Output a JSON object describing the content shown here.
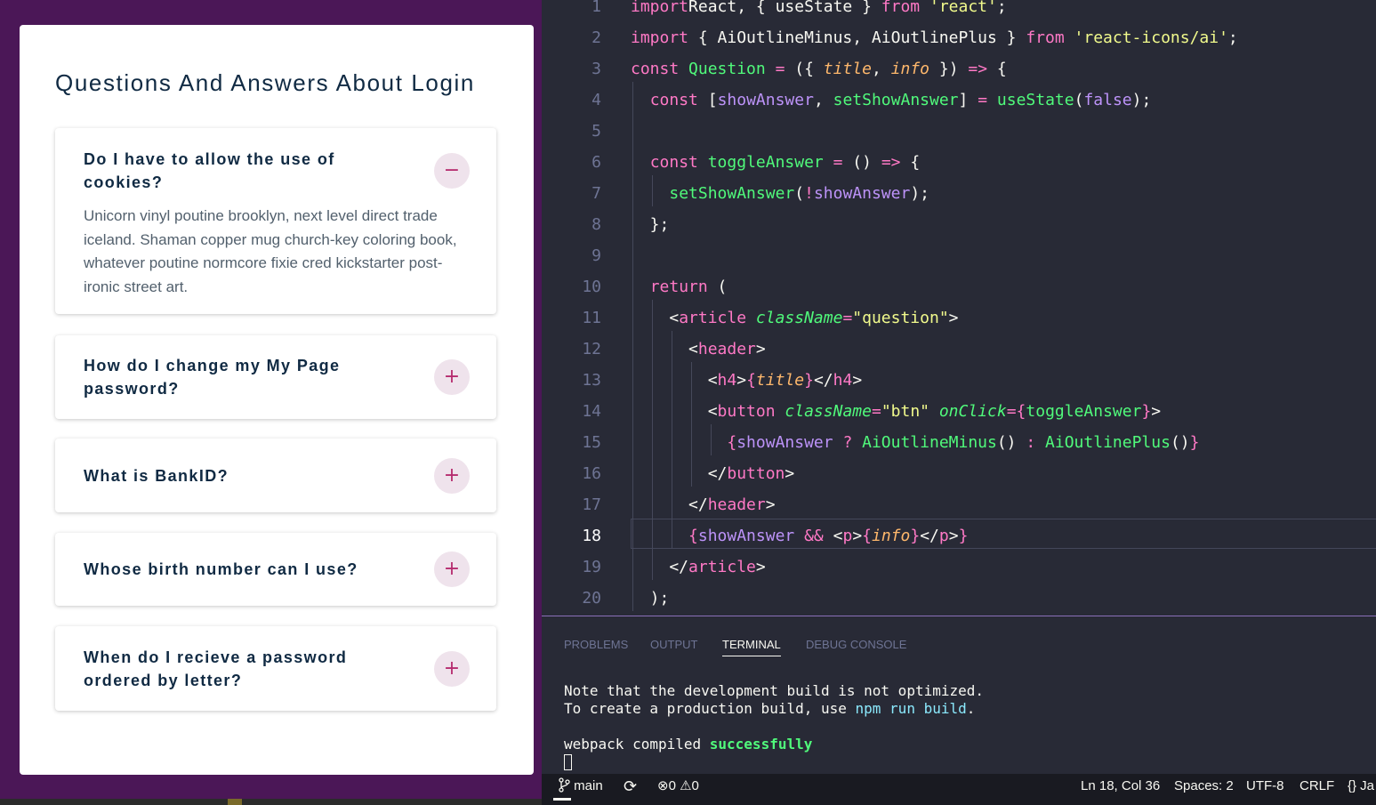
{
  "app": {
    "title": "Questions And Answers About Login",
    "questions": [
      {
        "title": "Do I have to allow the use of cookies?",
        "expanded": true,
        "button_icon": "minus-icon",
        "button_symbol": "−",
        "info": "Unicorn vinyl poutine brooklyn, next level direct trade iceland. Shaman copper mug church-key coloring book, whatever poutine normcore fixie cred kickstarter post-ironic street art."
      },
      {
        "title": "How do I change my My Page password?",
        "expanded": false,
        "button_icon": "plus-icon",
        "button_symbol": "+"
      },
      {
        "title": "What is BankID?",
        "expanded": false,
        "button_icon": "plus-icon",
        "button_symbol": "+"
      },
      {
        "title": "Whose birth number can I use?",
        "expanded": false,
        "button_icon": "plus-icon",
        "button_symbol": "+"
      },
      {
        "title": "When do I recieve a password ordered by letter?",
        "expanded": false,
        "button_icon": "plus-icon",
        "button_symbol": "+"
      }
    ]
  },
  "editor": {
    "current_line": 18,
    "lines": [
      {
        "n": "1",
        "tokens": [
          [
            "k",
            "import"
          ],
          [
            "",
            "React, { useState } "
          ],
          [
            "k",
            "from"
          ],
          [
            "",
            " "
          ],
          [
            "s",
            "'react'"
          ],
          [
            "",
            ";"
          ]
        ]
      },
      {
        "n": "2",
        "tokens": [
          [
            "k",
            "import"
          ],
          [
            "",
            " { AiOutlineMinus, AiOutlinePlus } "
          ],
          [
            "k",
            "from"
          ],
          [
            "",
            " "
          ],
          [
            "s",
            "'react-icons/ai'"
          ],
          [
            "",
            ";"
          ]
        ]
      },
      {
        "n": "3",
        "tokens": [
          [
            "k",
            "const"
          ],
          [
            "",
            " "
          ],
          [
            "f",
            "Question"
          ],
          [
            "",
            " "
          ],
          [
            "k",
            "="
          ],
          [
            "",
            " ({ "
          ],
          [
            "p",
            "title"
          ],
          [
            "",
            ", "
          ],
          [
            "p",
            "info"
          ],
          [
            "",
            " }) "
          ],
          [
            "k",
            "=>"
          ],
          [
            "",
            " {"
          ]
        ]
      },
      {
        "n": "4",
        "tokens": [
          [
            "",
            "  "
          ],
          [
            "k",
            "const"
          ],
          [
            "",
            " ["
          ],
          [
            "v",
            "showAnswer"
          ],
          [
            "",
            ", "
          ],
          [
            "f",
            "setShowAnswer"
          ],
          [
            "",
            "] "
          ],
          [
            "k",
            "="
          ],
          [
            "",
            " "
          ],
          [
            "f",
            "useState"
          ],
          [
            "",
            "("
          ],
          [
            "v",
            "false"
          ],
          [
            "",
            ");"
          ]
        ]
      },
      {
        "n": "5",
        "tokens": []
      },
      {
        "n": "6",
        "tokens": [
          [
            "",
            "  "
          ],
          [
            "k",
            "const"
          ],
          [
            "",
            " "
          ],
          [
            "f",
            "toggleAnswer"
          ],
          [
            "",
            " "
          ],
          [
            "k",
            "="
          ],
          [
            "",
            " () "
          ],
          [
            "k",
            "=>"
          ],
          [
            "",
            " {"
          ]
        ]
      },
      {
        "n": "7",
        "tokens": [
          [
            "",
            "    "
          ],
          [
            "f",
            "setShowAnswer"
          ],
          [
            "",
            "("
          ],
          [
            "k",
            "!"
          ],
          [
            "v",
            "showAnswer"
          ],
          [
            "",
            ");"
          ]
        ]
      },
      {
        "n": "8",
        "tokens": [
          [
            "",
            "  };"
          ]
        ]
      },
      {
        "n": "9",
        "tokens": []
      },
      {
        "n": "10",
        "tokens": [
          [
            "",
            "  "
          ],
          [
            "k",
            "return"
          ],
          [
            "",
            " ("
          ]
        ]
      },
      {
        "n": "11",
        "tokens": [
          [
            "",
            "    <"
          ],
          [
            "k",
            "article"
          ],
          [
            "",
            " "
          ],
          [
            "a",
            "className"
          ],
          [
            "k",
            "="
          ],
          [
            "s",
            "\"question\""
          ],
          [
            "",
            ">"
          ]
        ]
      },
      {
        "n": "12",
        "tokens": [
          [
            "",
            "      <"
          ],
          [
            "k",
            "header"
          ],
          [
            "",
            ">"
          ]
        ]
      },
      {
        "n": "13",
        "tokens": [
          [
            "",
            "        <"
          ],
          [
            "k",
            "h4"
          ],
          [
            "",
            ">"
          ],
          [
            "k",
            "{"
          ],
          [
            "p",
            "title"
          ],
          [
            "k",
            "}"
          ],
          [
            "",
            "</"
          ],
          [
            "k",
            "h4"
          ],
          [
            "",
            ">"
          ]
        ]
      },
      {
        "n": "14",
        "tokens": [
          [
            "",
            "        <"
          ],
          [
            "k",
            "button"
          ],
          [
            "",
            " "
          ],
          [
            "a",
            "className"
          ],
          [
            "k",
            "="
          ],
          [
            "s",
            "\"btn\""
          ],
          [
            "",
            " "
          ],
          [
            "a",
            "onClick"
          ],
          [
            "k",
            "={"
          ],
          [
            "f",
            "toggleAnswer"
          ],
          [
            "k",
            "}"
          ],
          [
            "",
            ">"
          ]
        ]
      },
      {
        "n": "15",
        "tokens": [
          [
            "",
            "          "
          ],
          [
            "k",
            "{"
          ],
          [
            "v",
            "showAnswer"
          ],
          [
            "",
            " "
          ],
          [
            "k",
            "?"
          ],
          [
            "",
            " "
          ],
          [
            "f",
            "AiOutlineMinus"
          ],
          [
            "",
            "() "
          ],
          [
            "k",
            ":"
          ],
          [
            "",
            " "
          ],
          [
            "f",
            "AiOutlinePlus"
          ],
          [
            "",
            "()"
          ],
          [
            "k",
            "}"
          ]
        ]
      },
      {
        "n": "16",
        "tokens": [
          [
            "",
            "        </"
          ],
          [
            "k",
            "button"
          ],
          [
            "",
            ">"
          ]
        ]
      },
      {
        "n": "17",
        "tokens": [
          [
            "",
            "      </"
          ],
          [
            "k",
            "header"
          ],
          [
            "",
            ">"
          ]
        ]
      },
      {
        "n": "18",
        "tokens": [
          [
            "",
            "      "
          ],
          [
            "k",
            "{"
          ],
          [
            "v",
            "showAnswer"
          ],
          [
            "",
            " "
          ],
          [
            "k",
            "&&"
          ],
          [
            "",
            " <"
          ],
          [
            "k",
            "p"
          ],
          [
            "",
            ">"
          ],
          [
            "k",
            "{"
          ],
          [
            "p",
            "info"
          ],
          [
            "k",
            "}"
          ],
          [
            "",
            "</"
          ],
          [
            "k",
            "p"
          ],
          [
            "",
            ">"
          ],
          [
            "k",
            "}"
          ]
        ]
      },
      {
        "n": "19",
        "tokens": [
          [
            "",
            "    </"
          ],
          [
            "k",
            "article"
          ],
          [
            "",
            ">"
          ]
        ]
      },
      {
        "n": "20",
        "tokens": [
          [
            "",
            "  );"
          ]
        ]
      }
    ]
  },
  "panel": {
    "tabs": [
      "PROBLEMS",
      "OUTPUT",
      "TERMINAL",
      "DEBUG CONSOLE"
    ],
    "active_tab": "TERMINAL",
    "terminal": {
      "line1": "Note that the development build is not optimized.",
      "line2_pre": "To create a production build, use ",
      "line2_cmd": "npm run build",
      "line2_post": ".",
      "line3_pre": "webpack compiled ",
      "line3_status": "successfully"
    }
  },
  "statusbar": {
    "branch": "main",
    "errors": "0",
    "warnings": "0",
    "position": "Ln 18, Col 36",
    "spaces": "Spaces: 2",
    "encoding": "UTF-8",
    "eol": "CRLF",
    "language": "{} Ja"
  },
  "colors": {
    "purple_bg": "#4b1757",
    "editor_bg": "#282a36",
    "accent": "#b62c6f"
  }
}
